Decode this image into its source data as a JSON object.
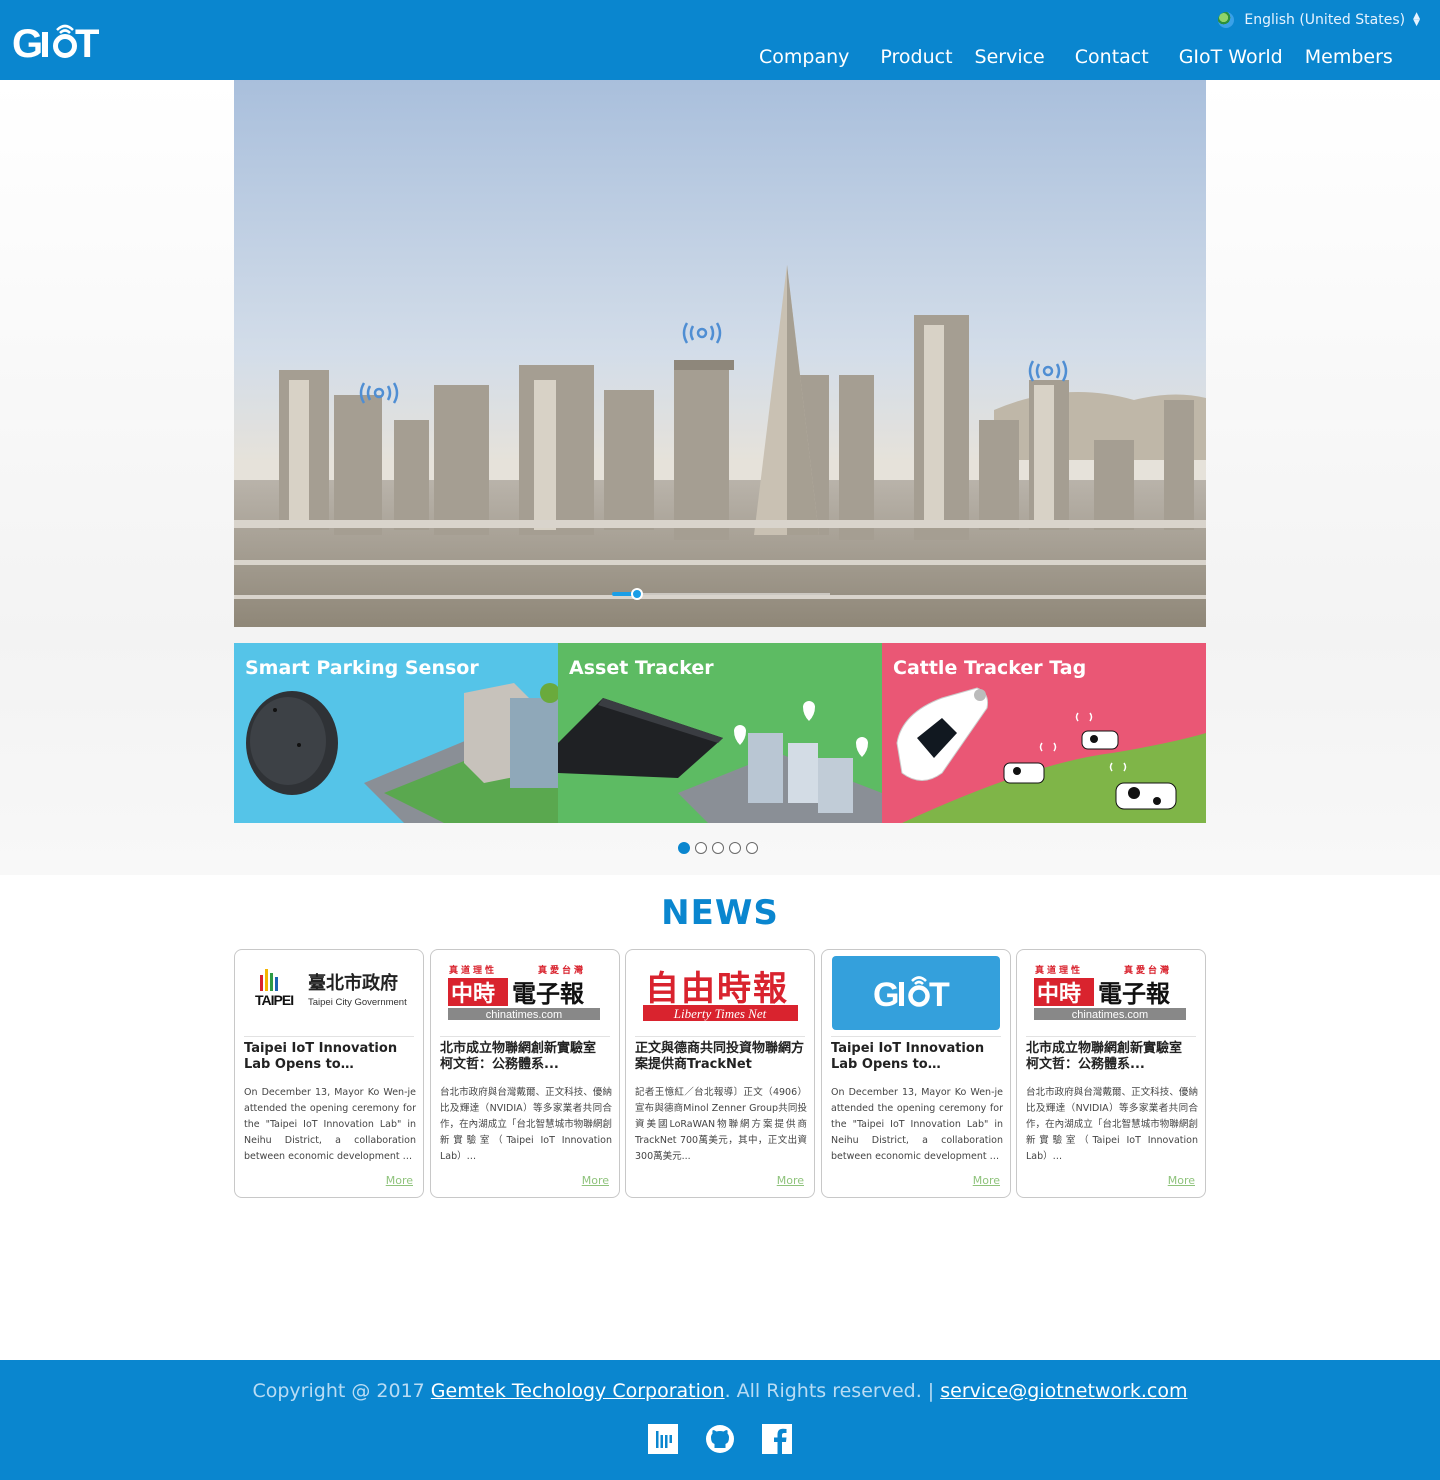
{
  "header": {
    "language": "English (United States)",
    "nav": [
      "Company",
      "Product",
      "Service",
      "Contact",
      "GIoT World",
      "Members"
    ]
  },
  "tiles": [
    {
      "title": "Smart Parking Sensor",
      "color": "#55c4e8"
    },
    {
      "title": "Asset Tracker",
      "color": "#5dbb63"
    },
    {
      "title": "Cattle Tracker Tag",
      "color": "#ea5775"
    }
  ],
  "carousel": {
    "pages": 5,
    "active": 1
  },
  "news": {
    "title": "NEWS",
    "more_label": "More",
    "cards": [
      {
        "logo": "Taipei City Government",
        "title": "Taipei IoT Innovation Lab Opens to…",
        "body": "On December 13, Mayor Ko Wen-je attended the opening ceremony for the \"Taipei IoT Innovation Lab\" in Neihu District, a collaboration between economic development …"
      },
      {
        "logo": "chinatimes.com",
        "title": "北市成立物聯網創新實驗室 柯文哲：公務體系...",
        "body": "台北市政府與台灣戴爾、正文科技、優納比及輝達（NVIDIA）等多家業者共同合作，在內湖成立「台北智慧城市物聯網創新實驗室（Taipei IoT Innovation Lab）…"
      },
      {
        "logo": "Liberty Times Net",
        "title": "正文與德商共同投資物聯網方案提供商TrackNet",
        "body": "記者王憶紅／台北報導〕正文（4906）宣布與德商Minol Zenner Group共同投資美國LoRaWAN物聯網方案提供商TrackNet 700萬美元，其中，正文出資300萬美元..."
      },
      {
        "logo": "GIoT",
        "title": "Taipei IoT Innovation Lab Opens to…",
        "body": "On December 13, Mayor Ko Wen-je attended the opening ceremony for the \"Taipei IoT Innovation Lab\" in Neihu District, a collaboration between economic development …"
      },
      {
        "logo": "chinatimes.com",
        "title": "北市成立物聯網創新實驗室 柯文哲：公務體系...",
        "body": "台北市政府與台灣戴爾、正文科技、優納比及輝達（NVIDIA）等多家業者共同合作，在內湖成立「台北智慧城市物聯網創新實驗室（Taipei IoT Innovation Lab）…"
      }
    ]
  },
  "footer": {
    "prefix": "Copyright @ 2017 ",
    "company": "Gemtek Techology Corporation",
    "middle": ". All Rights reserved. | ",
    "email": "service@giotnetwork.com",
    "social": [
      "gitter-icon",
      "github-icon",
      "facebook-icon"
    ]
  },
  "colors": {
    "brand": "#0a86cf",
    "more_link": "#8fc37c"
  }
}
